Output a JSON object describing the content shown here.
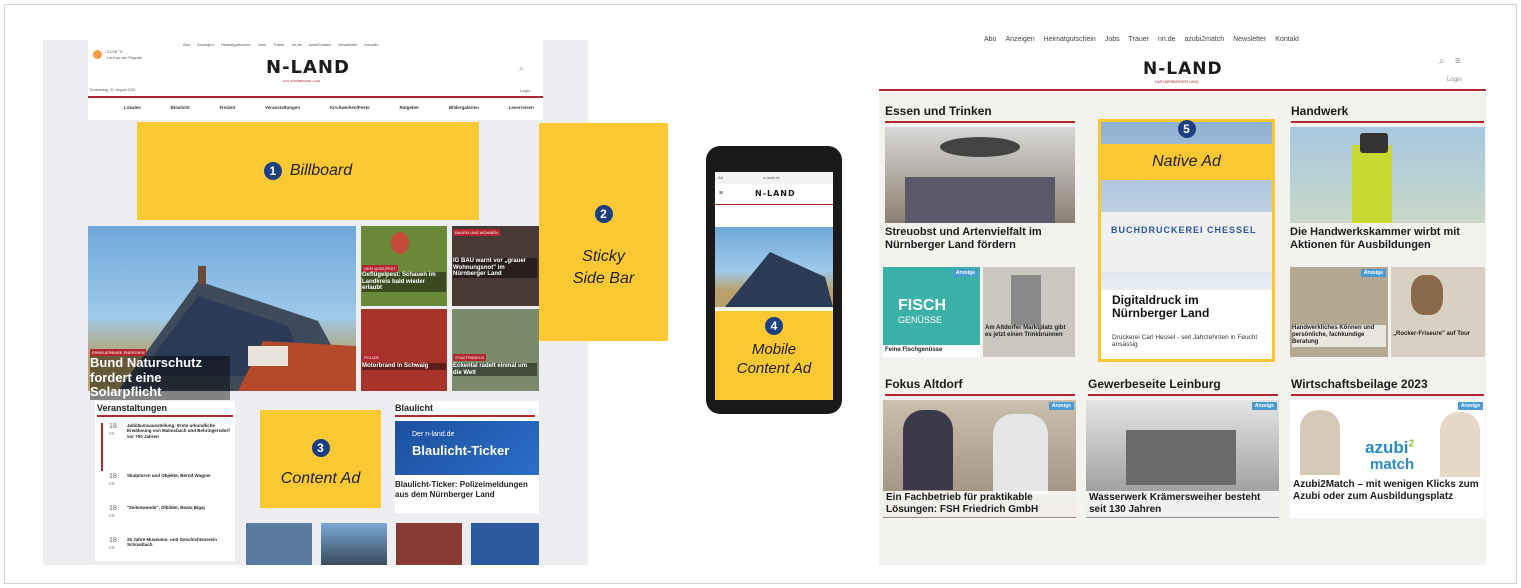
{
  "left": {
    "weather": {
      "temp": "21/26 °C",
      "location": "Lauf an der Pegnitz"
    },
    "topnav": [
      "Abo",
      "Anzeigen",
      "Heimatgutschein",
      "Jobs",
      "Trauer",
      "nn.de",
      "azubi2match",
      "Newsletter",
      "Kontakt"
    ],
    "logo": "N-LAND",
    "tagline": "DAS NÜRNBERGER LAND",
    "date": "Donnerstag, 31. August 2023",
    "login": "Login",
    "mainnav": [
      "Lokales",
      "Blaulicht",
      "Freizeit",
      "Veranstaltungen",
      "Kirchweihen/Feste",
      "Ratgeber",
      "Bildergalerien",
      "Leserreisen"
    ],
    "hero": {
      "label": "ERNEUERBARE ENERGIEN",
      "headline": "Bund Naturschutz fordert eine Solarpflicht"
    },
    "articles": [
      {
        "label": "GEFLÜGELPEST",
        "headline": "Geflügelpest: Schauen im Landkreis bald wieder erlaubt"
      },
      {
        "label": "BAUEN UND WOHNEN",
        "headline": "IG BAU warnt vor „grauer Wohnungsnot\" im Nürnberger Land"
      },
      {
        "label": "POLIZEI",
        "headline": "Motorbrand in Schwaig"
      },
      {
        "label": "STADTRADELN",
        "headline": "Eckental radelt einmal um die Welt"
      }
    ],
    "events_title": "Veranstaltungen",
    "events": [
      {
        "day": "18",
        "mon": "FR",
        "title": "Jubiläumsausstellung: Erste urkundliche Erwähnung von Malmsbach und Behringersdorf vor 700 Jahren"
      },
      {
        "day": "18",
        "mon": "FR",
        "title": "Skulpturen und Objekte, Bernd Wagner"
      },
      {
        "day": "18",
        "mon": "FR",
        "title": "\"Zeitenwende\", Ölbilder, Beata Bigaj"
      },
      {
        "day": "18",
        "mon": "FR",
        "title": "25 Jahre Museums- und Geschichtsverein Schnaittach"
      }
    ],
    "blaulicht": {
      "title": "Blaulicht",
      "ticker_top": "Der n-land.de",
      "ticker": "Blaulicht-Ticker",
      "headline": "Blaulicht-Ticker: Polizeimeldungen aus dem Nürnberger Land"
    }
  },
  "ads": {
    "billboard": {
      "num": "1",
      "label": "Billboard"
    },
    "sticky": {
      "num": "2",
      "line1": "Sticky",
      "line2": "Side Bar"
    },
    "content": {
      "num": "3",
      "label": "Content Ad"
    },
    "mobile": {
      "num": "4",
      "line1": "Mobile",
      "line2": "Content Ad"
    },
    "native": {
      "num": "5",
      "label": "Native Ad"
    }
  },
  "phone": {
    "aa": "AA",
    "url": "n-land.de",
    "logo": "N-LAND"
  },
  "right": {
    "topnav": [
      "Abo",
      "Anzeigen",
      "Heimatgutschein",
      "Jobs",
      "Trauer",
      "nn.de",
      "azubi2match",
      "Newsletter",
      "Kontakt"
    ],
    "logo": "N-LAND",
    "tagline": "DAS NÜRNBERGER LAND",
    "login": "Login",
    "sections": [
      "Essen und Trinken",
      "Handwerk",
      "Fokus Altdorf",
      "Gewerbeseite Leinburg",
      "Wirtschaftsbeilage 2023"
    ],
    "cards": {
      "essen": "Streuobst und Artenvielfalt im Nürnberger Land fördern",
      "fisch_small": "Feine Fischgenüsse",
      "fisch_logo1": "FISCH",
      "fisch_logo2": "GENÜSSE",
      "brunnen": "Am Altdorfer Marktplatz gibt es jetzt einen Trinkbrunnen",
      "native_title": "Digitaldruck im Nürnberger Land",
      "native_sub": "Druckerei Carl Hessel - seit Jahrzehnten in Feucht ansässig",
      "native_sign": "BUCHDRUCKEREI CHESSEL",
      "handwerk": "Die Handwerkskammer wirbt mit Aktionen für Ausbildungen",
      "hw_small1": "Handwerkliches Können und persönliche, fachkundige Beratung",
      "hw_small2": "„Rocker-Friseure\" auf Tour",
      "altdorf": "Ein Fachbetrieb für praktikable Lösungen: FSH Friedrich GmbH",
      "leinburg": "Wasserwerk Krämersweiher besteht seit 130 Jahren",
      "wirtschaft": "Azubi2Match – mit wenigen Klicks zum Azubi oder zum Ausbildungsplatz",
      "azubi_logo": "azubi",
      "azubi_sup": "2",
      "azubi_logo2": "match"
    },
    "anzeige": "Anzeige"
  }
}
